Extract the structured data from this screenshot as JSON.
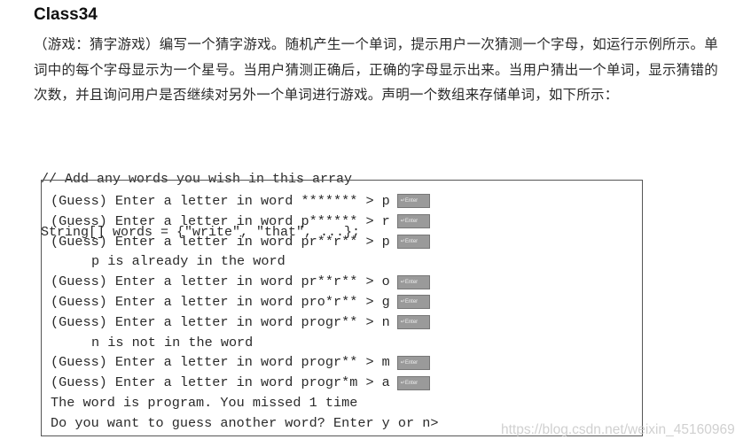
{
  "title": "Class34",
  "description": "（游戏：猜字游戏）编写一个猜字游戏。随机产生一个单词，提示用户一次猜测一个字母，如运行示例所示。单词中的每个字母显示为一个星号。当用户猜测正确后，正确的字母显示出来。当用户猜出一个单词，显示猜错的次数，并且询问用户是否继续对另外一个单词进行游戏。声明一个数组来存储单词，如下所示：",
  "code": [
    "// Add any words you wish in this array",
    "String[] words = {\"write\", \"that\", ...};"
  ],
  "enter_key_label": "↵Enter",
  "sample_run": [
    {
      "text": "(Guess) Enter a letter in word ******* > p",
      "enter": true
    },
    {
      "text": "(Guess) Enter a letter in word p****** > r",
      "enter": true
    },
    {
      "text": "(Guess) Enter a letter in word pr**r** > p",
      "enter": true
    },
    {
      "text": "p is already in the word",
      "indent": true
    },
    {
      "text": "(Guess) Enter a letter in word pr**r** > o",
      "enter": true
    },
    {
      "text": "(Guess) Enter a letter in word pro*r** > g",
      "enter": true
    },
    {
      "text": "(Guess) Enter a letter in word progr** > n",
      "enter": true
    },
    {
      "text": "n is not in the word",
      "indent": true
    },
    {
      "text": "(Guess) Enter a letter in word progr** > m",
      "enter": true
    },
    {
      "text": "(Guess) Enter a letter in word progr*m > a",
      "enter": true
    },
    {
      "text": "The word is program. You missed 1 time"
    },
    {
      "text": "Do you want to guess another word? Enter y or n>"
    }
  ],
  "watermark": "https://blog.csdn.net/weixin_45160969"
}
